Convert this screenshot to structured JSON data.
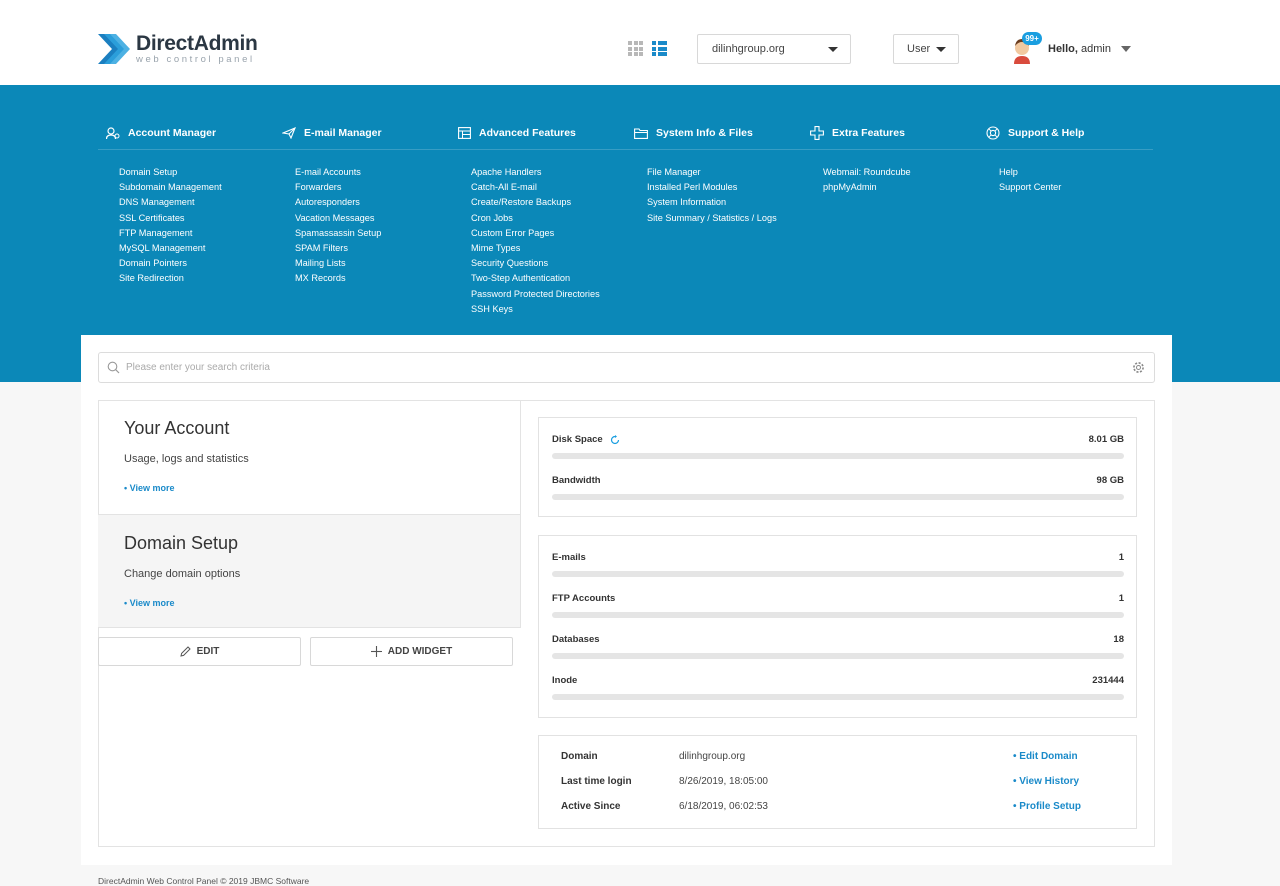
{
  "header": {
    "logo_title": "DirectAdmin",
    "logo_subtitle": "web control panel",
    "domain_select": "dilinhgroup.org",
    "user_select": "User",
    "badge": "99+",
    "hello_prefix": "Hello,",
    "hello_user": "admin"
  },
  "menu": [
    {
      "title": "Account Manager",
      "icon": "account-icon",
      "items": [
        "Domain Setup",
        "Subdomain Management",
        "DNS Management",
        "SSL Certificates",
        "FTP Management",
        "MySQL Management",
        "Domain Pointers",
        "Site Redirection"
      ]
    },
    {
      "title": "E-mail Manager",
      "icon": "paper-plane-icon",
      "items": [
        "E-mail Accounts",
        "Forwarders",
        "Autoresponders",
        "Vacation Messages",
        "Spamassassin Setup",
        "SPAM Filters",
        "Mailing Lists",
        "MX Records"
      ]
    },
    {
      "title": "Advanced Features",
      "icon": "table-icon",
      "items": [
        "Apache Handlers",
        "Catch-All E-mail",
        "Create/Restore Backups",
        "Cron Jobs",
        "Custom Error Pages",
        "Mime Types",
        "Security Questions",
        "Two-Step Authentication",
        "Password Protected Directories",
        "SSH Keys"
      ]
    },
    {
      "title": "System Info & Files",
      "icon": "folder-icon",
      "items": [
        "File Manager",
        "Installed Perl Modules",
        "System Information",
        "Site Summary / Statistics / Logs"
      ]
    },
    {
      "title": "Extra Features",
      "icon": "plus-icon",
      "items": [
        "Webmail: Roundcube",
        "phpMyAdmin"
      ]
    },
    {
      "title": "Support & Help",
      "icon": "lifebuoy-icon",
      "items": [
        "Help",
        "Support Center"
      ]
    }
  ],
  "search": {
    "placeholder": "Please enter your search criteria"
  },
  "widgets": [
    {
      "title": "Your Account",
      "desc": "Usage, logs and statistics",
      "more": "• View more"
    },
    {
      "title": "Domain Setup",
      "desc": "Change domain options",
      "more": "• View more"
    }
  ],
  "buttons": {
    "edit": "EDIT",
    "add_widget": "ADD WIDGET"
  },
  "stats_usage": [
    {
      "label": "Disk Space",
      "value": "8.01 GB"
    },
    {
      "label": "Bandwidth",
      "value": "98 GB"
    }
  ],
  "stats_counts": [
    {
      "label": "E-mails",
      "value": "1"
    },
    {
      "label": "FTP Accounts",
      "value": "1"
    },
    {
      "label": "Databases",
      "value": "18"
    },
    {
      "label": "Inode",
      "value": "231444"
    }
  ],
  "info": [
    {
      "label": "Domain",
      "value": "dilinhgroup.org",
      "link": "• Edit Domain"
    },
    {
      "label": "Last time login",
      "value": "8/26/2019, 18:05:00",
      "link": "• View History"
    },
    {
      "label": "Active Since",
      "value": "6/18/2019, 06:02:53",
      "link": "• Profile Setup"
    }
  ],
  "footer": "DirectAdmin Web Control Panel © 2019 JBMC Software",
  "colors": {
    "accent": "#0b88b8",
    "link": "#1a8ac9"
  }
}
